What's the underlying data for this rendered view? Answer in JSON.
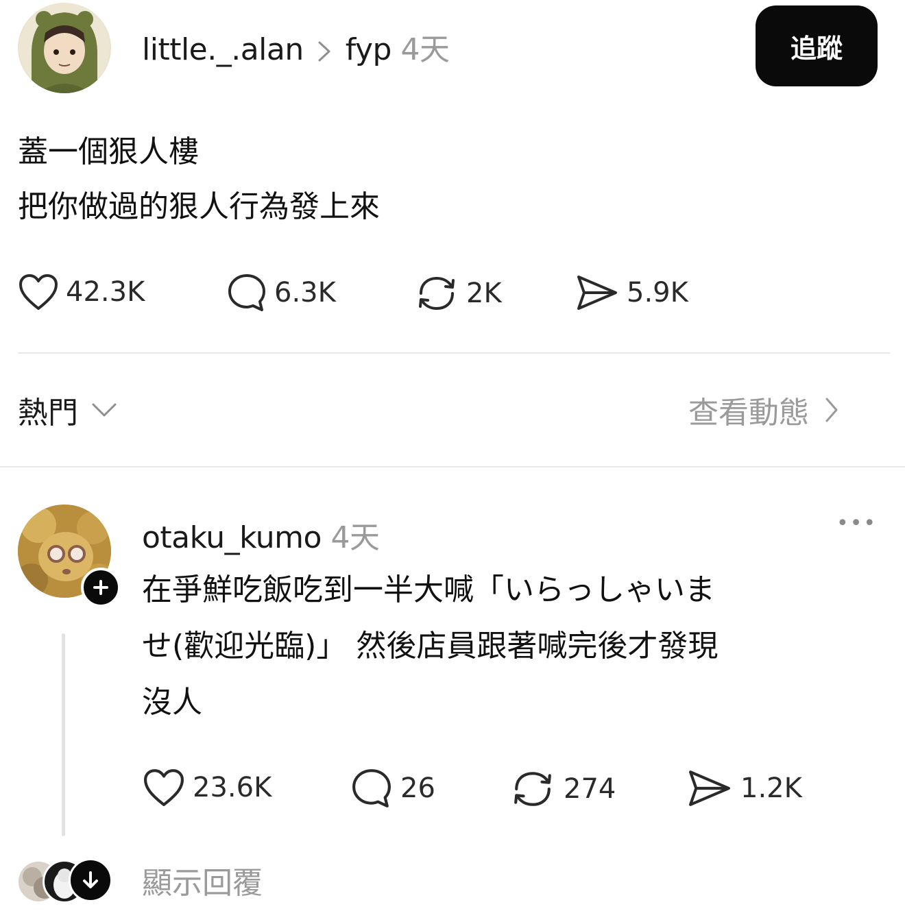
{
  "post": {
    "username": "little._.alan",
    "separator": ">",
    "topic": "fyp",
    "time": "4天",
    "follow_label": "追蹤",
    "lines": [
      "蓋一個狠人樓",
      "把你做過的狠人行為發上來"
    ],
    "stats": {
      "likes": "42.3K",
      "comments": "6.3K",
      "reposts": "2K",
      "shares": "5.9K"
    }
  },
  "sort": {
    "label": "熱門",
    "view_activity": "查看動態"
  },
  "reply": {
    "username": "otaku_kumo",
    "time": "4天",
    "more": "•••",
    "lines": [
      "在爭鮮吃飯吃到一半大喊「いらっしゃいま",
      "せ(歡迎光臨)」 然後店員跟著喊完後才發現",
      "沒人"
    ],
    "stats": {
      "likes": "23.6K",
      "comments": "26",
      "reposts": "274",
      "shares": "1.2K"
    },
    "show_replies": "顯示回覆"
  },
  "colors": {
    "follow_bg": "#0a0a0a",
    "muted": "#9a9a9a",
    "divider": "#e8e8e8"
  }
}
